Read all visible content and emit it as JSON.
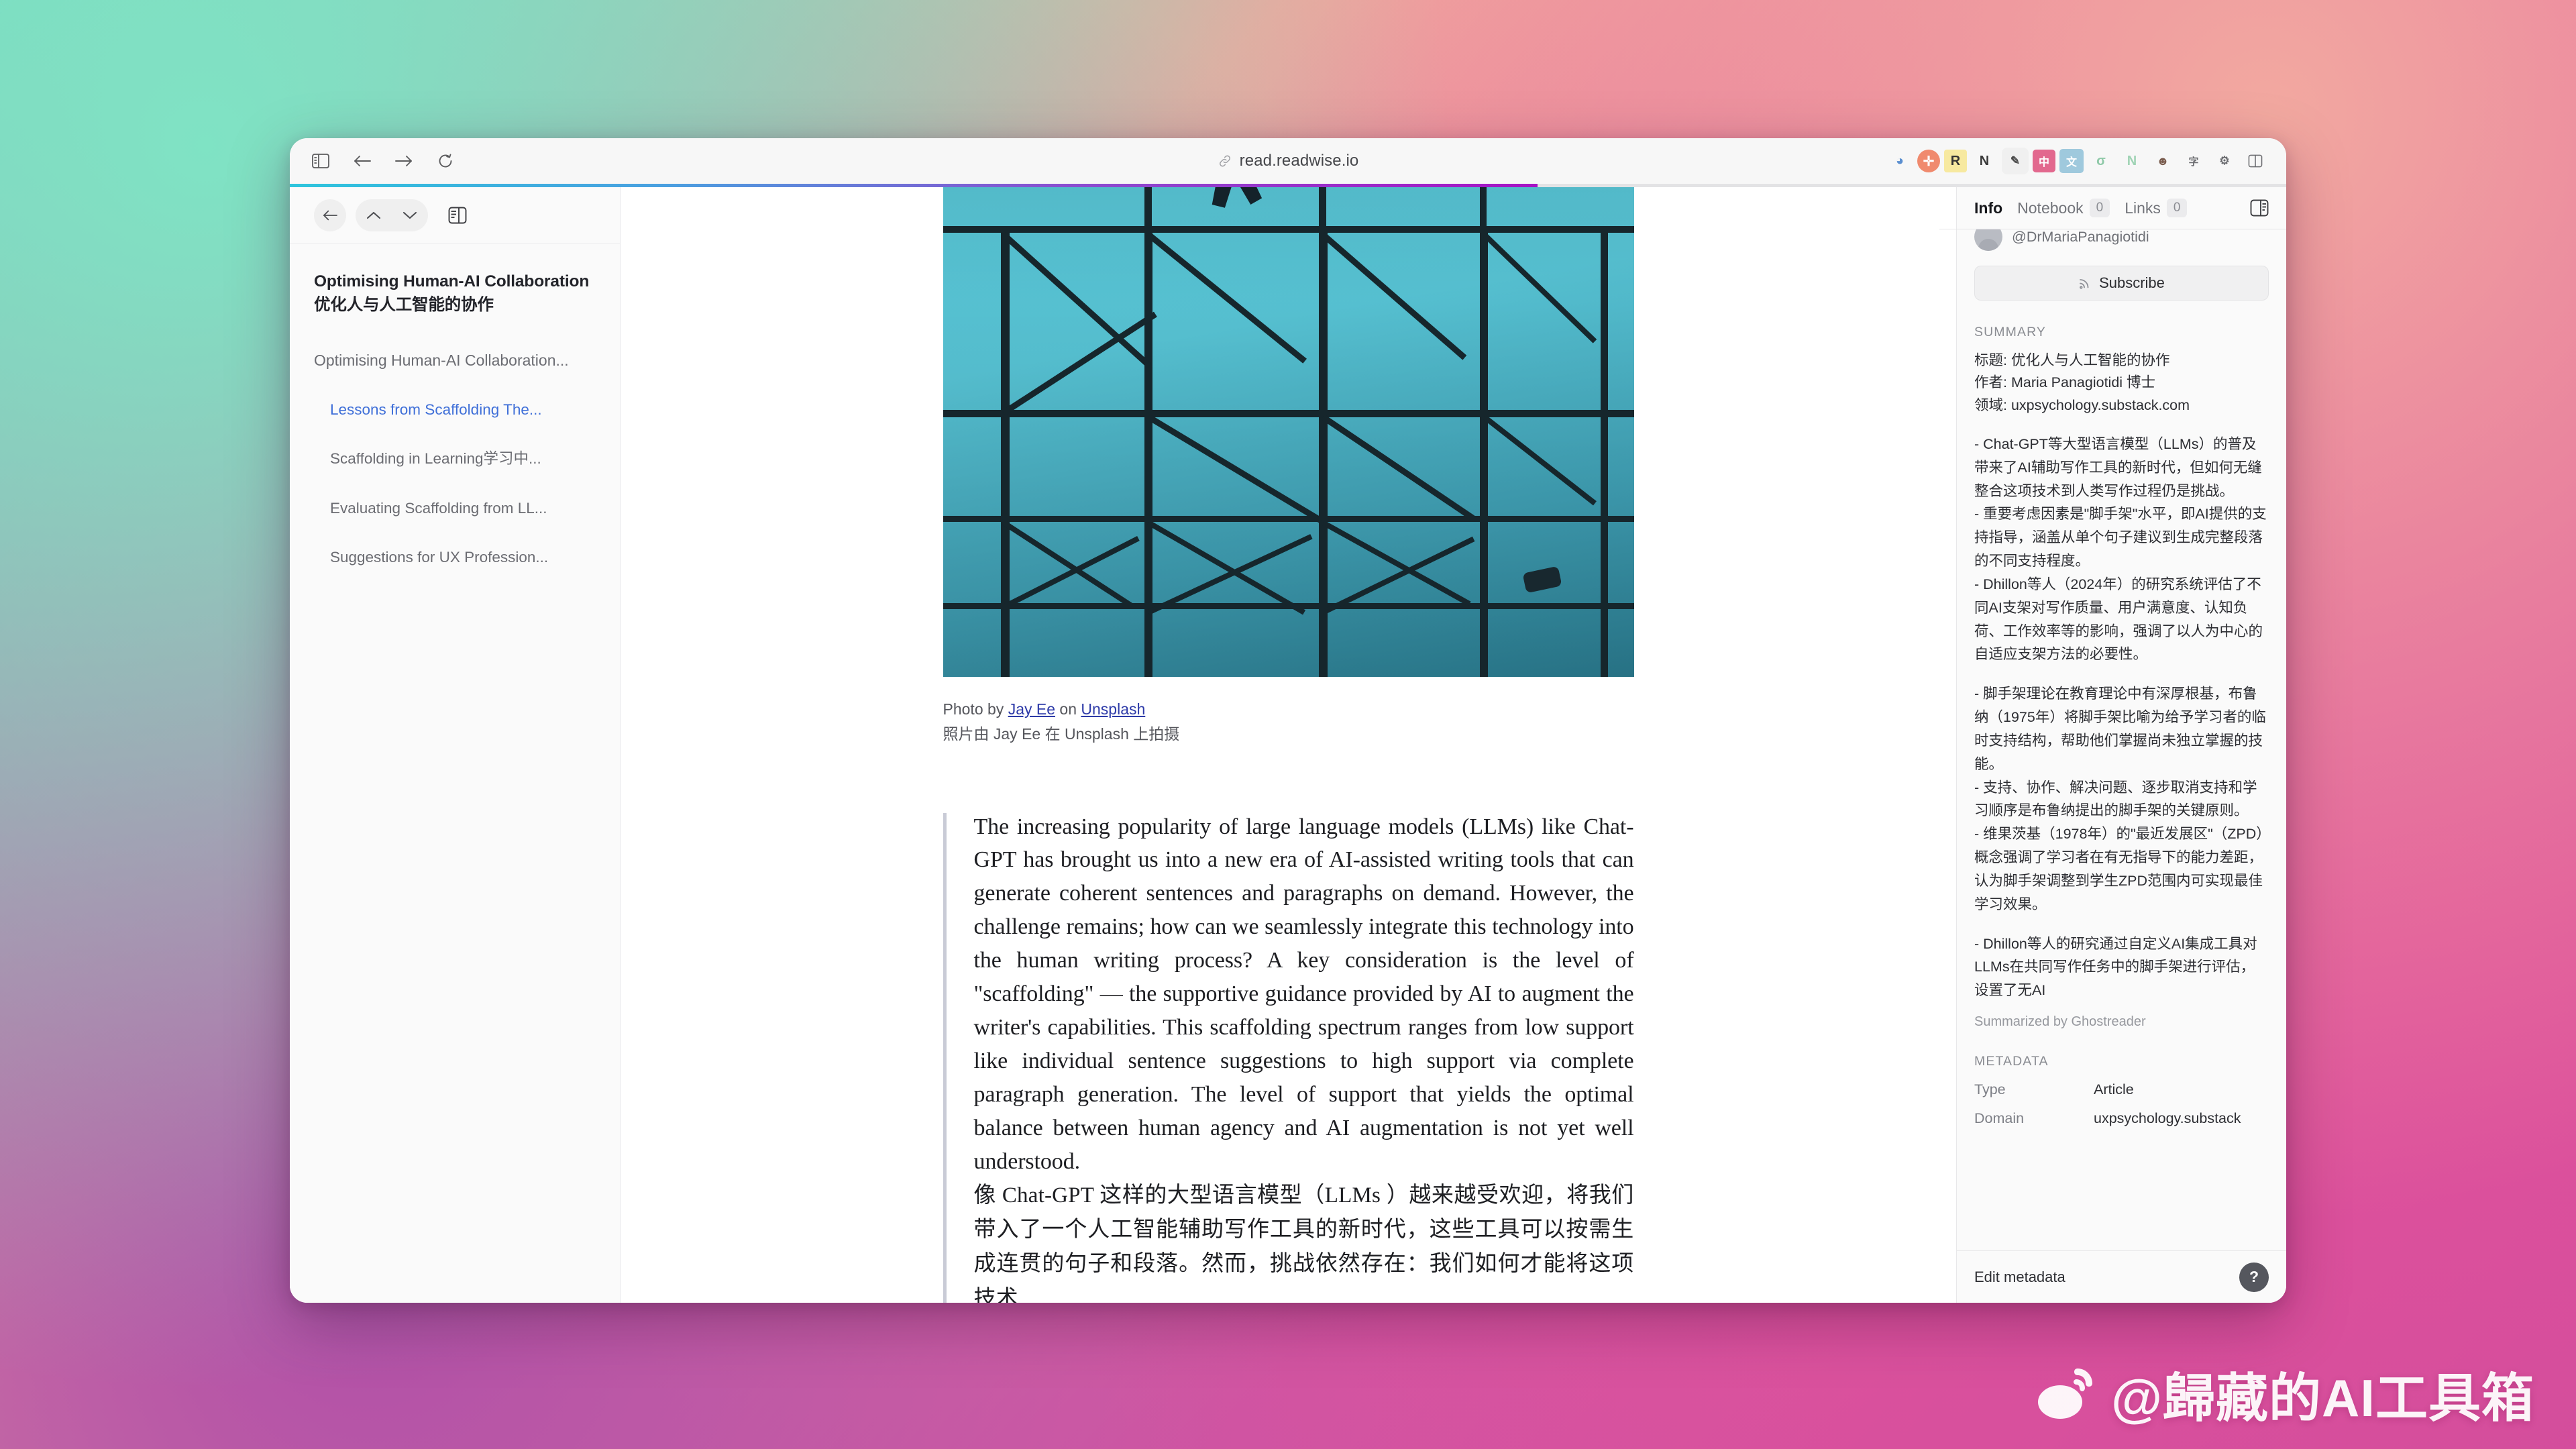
{
  "browser": {
    "url": "read.readwise.io",
    "nav": {
      "sidebar_toggle": "sidebar-toggle",
      "back": "back",
      "forward": "forward",
      "reload": "reload"
    },
    "extensions": [
      {
        "name": "privacy-badger-icon",
        "glyph": "◕",
        "color": "#5b8fd0",
        "bg": "transparent"
      },
      {
        "name": "adblock-icon",
        "glyph": "✛",
        "color": "#ffffff",
        "bg": "#f08a6e"
      },
      {
        "name": "readwise-icon",
        "glyph": "R",
        "color": "#3a3a3a",
        "bg": "#f7e9a0"
      },
      {
        "name": "notion-icon",
        "glyph": "N",
        "color": "#3a3a3a",
        "bg": "transparent"
      },
      {
        "name": "note-clipper-icon",
        "glyph": "✎",
        "color": "#4a4a4a",
        "bg": "#f0f0f0"
      },
      {
        "name": "translate-cn-icon",
        "glyph": "中",
        "color": "#ffffff",
        "bg": "#e2688e"
      },
      {
        "name": "immersive-translate-icon",
        "glyph": "文",
        "color": "#ffffff",
        "bg": "#7fb2cc"
      },
      {
        "name": "grammar-icon",
        "glyph": "σ",
        "color": "#8fc9a8",
        "bg": "transparent"
      },
      {
        "name": "nota-icon",
        "glyph": "N",
        "color": "#9fd3b4",
        "bg": "transparent"
      },
      {
        "name": "profile-avatar-icon",
        "glyph": "☻",
        "color": "#7a5c4e",
        "bg": "transparent"
      },
      {
        "name": "comment-cn-icon",
        "glyph": "字",
        "color": "#6a6b6f",
        "bg": "transparent"
      },
      {
        "name": "settings-sliders-icon",
        "glyph": "⚙",
        "color": "#6a6b6f",
        "bg": "transparent"
      },
      {
        "name": "split-view-icon",
        "glyph": "▯",
        "color": "#6a6b6f",
        "bg": "transparent"
      }
    ]
  },
  "sidebar": {
    "doc_title_en": "Optimising Human-AI Collaboration",
    "doc_title_zh": "优化人与人工智能的协作",
    "toc_root": "Optimising Human-AI Collaboration...",
    "toc_items": [
      {
        "label": "Lessons from Scaffolding The...",
        "active": true
      },
      {
        "label": "Scaffolding in Learning学习中...",
        "active": false
      },
      {
        "label": "Evaluating Scaffolding from LL...",
        "active": false
      },
      {
        "label": "Suggestions for UX Profession...",
        "active": false
      }
    ]
  },
  "reader": {
    "photo_credit_prefix": "Photo by ",
    "photo_credit_author": "Jay Ee",
    "photo_credit_mid": " on ",
    "photo_credit_source": "Unsplash",
    "photo_credit_zh": "照片由 Jay Ee 在 Unsplash 上拍摄",
    "paragraph_en": "The increasing popularity of large language models (LLMs) like Chat-GPT has brought us into a new era of AI-assisted writing tools that can generate coherent sentences and paragraphs on demand. However, the challenge remains; how can we seamlessly integrate this technology into the human writing process? A key consideration is the level of \"scaffolding\" — the supportive guidance provided by AI to augment the writer's capabilities. This scaffolding spectrum ranges from low support like individual sentence suggestions to high support via complete paragraph generation. The level of support that yields the optimal balance between human agency and AI augmentation is not yet well understood.",
    "paragraph_zh": "像 Chat-GPT 这样的大型语言模型（LLMs ）越来越受欢迎，将我们带入了一个人工智能辅助写作工具的新时代，这些工具可以按需生成连贯的句子和段落。然而，挑战依然存在：我们如何才能将这项技术"
  },
  "rightpanel": {
    "tabs": [
      {
        "label": "Info",
        "count": null,
        "active": true
      },
      {
        "label": "Notebook",
        "count": "0",
        "active": false
      },
      {
        "label": "Links",
        "count": "0",
        "active": false
      }
    ],
    "author_handle": "@DrMariaPanagiotidi",
    "subscribe_label": "Subscribe",
    "summary_label": "SUMMARY",
    "summary_lines": [
      "标题: 优化人与人工智能的协作",
      "作者: Maria Panagiotidi 博士",
      "领域: uxpsychology.substack.com"
    ],
    "summary_bullets": [
      "- Chat-GPT等大型语言模型（LLMs）的普及带来了AI辅助写作工具的新时代，但如何无缝整合这项技术到人类写作过程仍是挑战。",
      "- 重要考虑因素是\"脚手架\"水平，即AI提供的支持指导，涵盖从单个句子建议到生成完整段落的不同支持程度。",
      "- Dhillon等人（2024年）的研究系统评估了不同AI支架对写作质量、用户满意度、认知负荷、工作效率等的影响，强调了以人为中心的自适应支架方法的必要性。"
    ],
    "summary_bullets2": [
      "- 脚手架理论在教育理论中有深厚根基，布鲁纳（1975年）将脚手架比喻为给予学习者的临时支持结构，帮助他们掌握尚未独立掌握的技能。",
      "- 支持、协作、解决问题、逐步取消支持和学习顺序是布鲁纳提出的脚手架的关键原则。",
      "- 维果茨基（1978年）的\"最近发展区\"（ZPD）概念强调了学习者在有无指导下的能力差距，认为脚手架调整到学生ZPD范围内可实现最佳学习效果。"
    ],
    "summary_bullets3": [
      "- Dhillon等人的研究通过自定义AI集成工具对LLMs在共同写作任务中的脚手架进行评估，设置了无AI"
    ],
    "ghostreader_note": "Summarized by Ghostreader",
    "metadata_label": "METADATA",
    "metadata_rows": [
      {
        "key": "Type",
        "value": "Article"
      },
      {
        "key": "Domain",
        "value": "uxpsychology.substack"
      }
    ],
    "edit_metadata_label": "Edit metadata",
    "help_label": "?"
  },
  "watermark": {
    "handle": "@歸藏的AI工具箱"
  },
  "colors": {
    "accent_link": "#3f6fd8",
    "progress_start": "#2ec5dd",
    "progress_end": "#a614c4"
  }
}
